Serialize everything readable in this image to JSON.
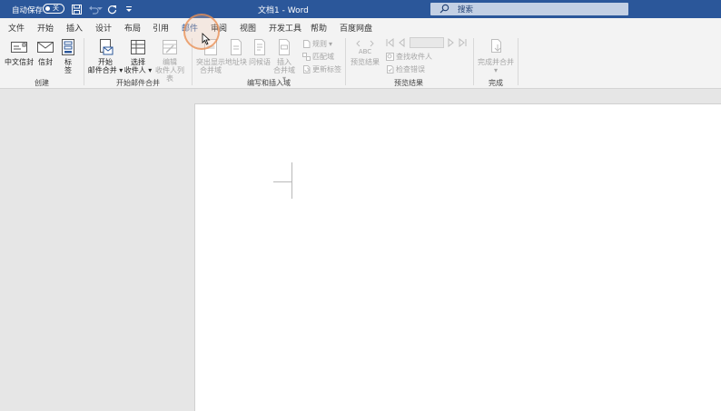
{
  "titlebar": {
    "autosave_label": "自动保存",
    "autosave_state": "关",
    "doc_title": "文档1  -  Word",
    "search_placeholder": "搜索"
  },
  "tabs": [
    "文件",
    "开始",
    "插入",
    "设计",
    "布局",
    "引用",
    "邮件",
    "审阅",
    "视图",
    "开发工具",
    "帮助",
    "百度网盘"
  ],
  "active_tab": "邮件",
  "ribbon": {
    "create": {
      "label": "创建",
      "chinese_envelope": "中文信封",
      "envelope": "信封",
      "labels_line1": "标",
      "labels_line2": "签"
    },
    "start_merge": {
      "label": "开始邮件合并",
      "start_line1": "开始",
      "start_line2": "邮件合并",
      "select_line1": "选择",
      "select_line2": "收件人",
      "edit_line1": "编辑",
      "edit_line2": "收件人列表"
    },
    "write_insert": {
      "label": "编写和插入域",
      "highlight_line1": "突出显示",
      "highlight_line2": "合并域",
      "address_block": "地址块",
      "greeting_line": "问候语",
      "insert_line1": "插入",
      "insert_line2": "合并域",
      "rules": "规则",
      "match_fields": "匹配域",
      "update_labels": "更新标签"
    },
    "preview": {
      "label": "预览结果",
      "preview_results": "预览结果",
      "preview_icon_text": "ABC",
      "find_recipient": "查找收件人",
      "check_errors": "检查错误"
    },
    "finish": {
      "label": "完成",
      "finish_merge": "完成并合并"
    }
  },
  "colors": {
    "title_bar": "#2b579a",
    "ribbon_bg": "#f3f3f3",
    "doc_bg": "#e6e6e6",
    "page_bg": "#ffffff"
  }
}
